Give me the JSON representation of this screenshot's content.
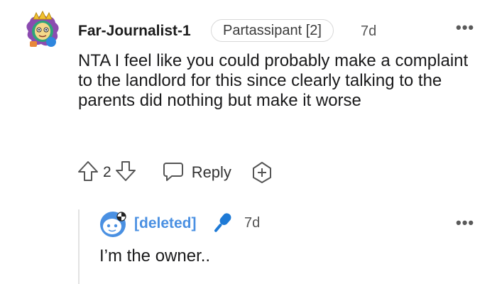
{
  "comment": {
    "author": "Far-Journalist-1",
    "flair": "Partassipant [2]",
    "time": "7d",
    "more_label": "•••",
    "body": "NTA I feel like you could probably make a complaint to the landlord for this since clearly talking to the parents did nothing but make it worse",
    "vote_count": "2",
    "reply_label": "Reply",
    "icons": [
      "avatar",
      "upvote-icon",
      "downvote-icon",
      "reply-icon",
      "award-icon",
      "more-icon"
    ]
  },
  "reply": {
    "author": "[deleted]",
    "time": "7d",
    "more_label": "•••",
    "body": "I’m the owner..",
    "icons": [
      "avatar",
      "microphone-icon",
      "more-icon"
    ]
  },
  "colors": {
    "deleted_author": "#4a90e2",
    "microphone": "#1e7ad6",
    "thread_line": "#e2e2e2"
  }
}
